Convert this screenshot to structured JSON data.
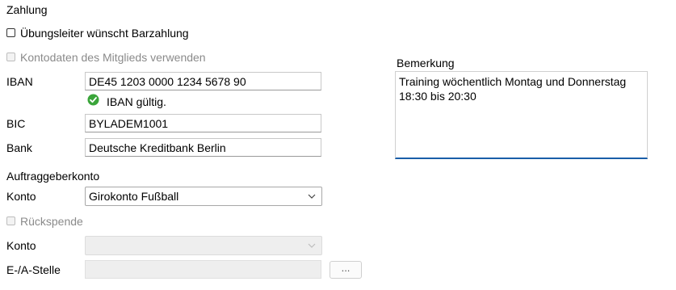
{
  "payment": {
    "section_title": "Zahlung",
    "cash_payment_label": "Übungsleiter wünscht Barzahlung",
    "use_member_account_label": "Kontodaten des Mitglieds verwenden",
    "iban_label": "IBAN",
    "iban_value": "DE45 1203 0000 1234 5678 90",
    "iban_status": "IBAN gültig.",
    "bic_label": "BIC",
    "bic_value": "BYLADEM1001",
    "bank_label": "Bank",
    "bank_value": "Deutsche Kreditbank Berlin"
  },
  "client_account": {
    "section_title": "Auftraggeberkonto",
    "account_label": "Konto",
    "account_value": "Girokonto Fußball"
  },
  "donation": {
    "ruckspende_label": "Rückspende",
    "account_label": "Konto",
    "account_value": "",
    "cost_center_label": "E-/A-Stelle",
    "cost_center_value": "",
    "browse_label": "..."
  },
  "remark": {
    "label": "Bemerkung",
    "value": "Training wöchentlich Montag und Donnerstag 18:30 bis 20:30"
  },
  "colors": {
    "valid_icon": "#3aa53a",
    "focus_underline": "#1a5ea8"
  },
  "icons": {
    "valid": "check-circle-icon",
    "dropdown": "chevron-down-icon"
  }
}
